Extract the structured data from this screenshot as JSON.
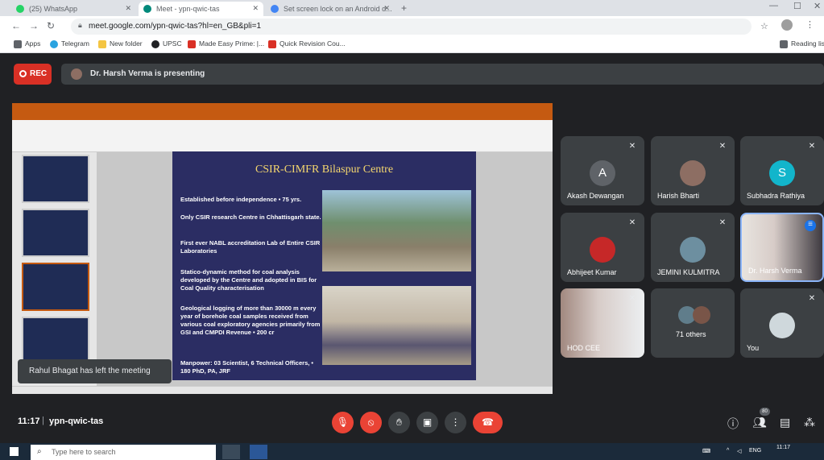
{
  "browser": {
    "tabs": [
      {
        "label": "(25) WhatsApp",
        "color": "#25d366"
      },
      {
        "label": "Meet - ypn-qwic-tas",
        "color": "#00897b"
      },
      {
        "label": "Set screen lock on an Android d...",
        "color": "#4285f4"
      }
    ],
    "url": "meet.google.com/ypn-qwic-tas?hl=en_GB&pli=1",
    "bookmarks": [
      {
        "label": "Apps",
        "color": "#5f6368"
      },
      {
        "label": "Telegram",
        "color": "#2aa3e0"
      },
      {
        "label": "New folder",
        "color": "#f4c542"
      },
      {
        "label": "UPSC",
        "color": "#202124"
      },
      {
        "label": "Made Easy Prime: |...",
        "color": "#d93025"
      },
      {
        "label": "Quick Revision Cou...",
        "color": "#d93025"
      }
    ],
    "reading_list": "Reading list"
  },
  "meet": {
    "rec_label": "REC",
    "presenting": "Dr. Harsh Verma is presenting",
    "toast": "Rahul Bhagat has left the meeting",
    "time": "11:17",
    "meeting_code": "ypn-qwic-tas",
    "participant_count": "80"
  },
  "slide": {
    "title": "CSIR-CIMFR Bilaspur Centre",
    "bullets": [
      "Established before independence • 75 yrs.",
      "Only CSIR research Centre in Chhattisgarh state.",
      "First ever NABL accreditation Lab of Entire CSIR Laboratories",
      "Statico-dynamic method for coal analysis developed by the Centre and adopted in BIS for Coal Quality characterisation",
      "Geological logging of more than 30000 m every year of borehole coal samples received from various coal exploratory agencies primarily from GSI and CMPDI Revenue • 200 cr",
      "Manpower: 03 Scientist, 6 Technical Officers, • 180 PhD, PA, JRF"
    ]
  },
  "participants": [
    {
      "name": "Akash Dewangan",
      "initial": "A",
      "color": "#5f6368"
    },
    {
      "name": "Harish Bharti",
      "initial": "",
      "color": "#8d6e63"
    },
    {
      "name": "Subhadra Rathiya",
      "initial": "S",
      "color": "#12b5cb"
    },
    {
      "name": "Abhijeet Kumar",
      "initial": "",
      "color": "#c62828"
    },
    {
      "name": "JEMINI KULMITRA",
      "initial": "",
      "color": "#6d8fa0"
    },
    {
      "name": "Dr. Harsh Verma",
      "initial": "",
      "color": "#d7ccc8"
    },
    {
      "name": "HOD CEE",
      "initial": "",
      "color": "#5d4037"
    },
    {
      "name": "71 others",
      "initial": "",
      "color": "#607d8b"
    },
    {
      "name": "You",
      "initial": "",
      "color": "#cfd8dc"
    }
  ],
  "taskbar": {
    "search_placeholder": "Type here to search",
    "lang": "ENG",
    "clock": "11:17"
  }
}
